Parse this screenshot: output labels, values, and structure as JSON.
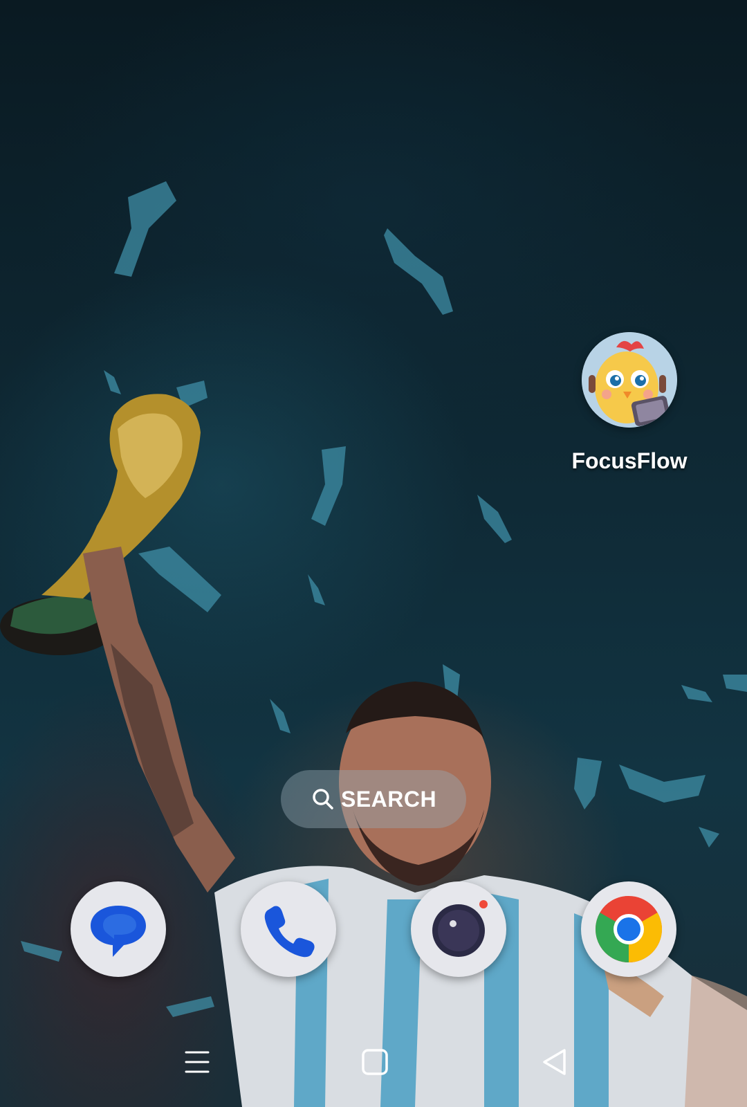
{
  "desktop": {
    "apps": [
      {
        "label": "FocusFlow",
        "icon": "focusflow-chick-icon"
      }
    ]
  },
  "search": {
    "label": "SEARCH",
    "icon": "search-icon"
  },
  "dock": {
    "items": [
      {
        "app": "messages",
        "icon": "messages-icon",
        "color": "#1a56db"
      },
      {
        "app": "phone",
        "icon": "phone-icon",
        "color": "#1a56db"
      },
      {
        "app": "camera",
        "icon": "camera-icon",
        "color": "#2b2a45"
      },
      {
        "app": "chrome",
        "icon": "chrome-icon",
        "color": "#ea4335"
      }
    ]
  },
  "navigation": {
    "buttons": [
      {
        "name": "recents",
        "icon": "menu-lines-icon"
      },
      {
        "name": "home",
        "icon": "square-home-icon"
      },
      {
        "name": "back",
        "icon": "triangle-back-icon"
      }
    ]
  },
  "wallpaper": {
    "icon": "wallpaper-photo"
  }
}
